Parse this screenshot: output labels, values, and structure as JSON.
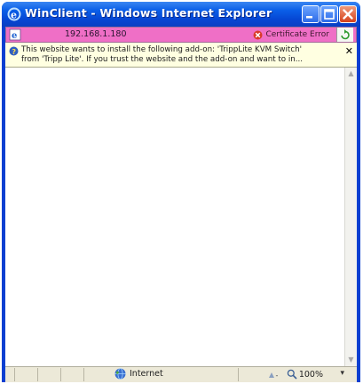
{
  "window": {
    "title": "WinClient - Windows Internet Explorer"
  },
  "address_bar": {
    "url": "192.168.1.180",
    "cert_error_label": "Certificate Error"
  },
  "info_bar": {
    "line1": "This website wants to install the following add-on: 'TrippLite KVM Switch'",
    "line2": "from 'Tripp Lite'. If you trust the website and the add-on and want to in..."
  },
  "status_bar": {
    "zone_label": "Internet",
    "zoom_label": "100%"
  },
  "icons": {
    "browser": "ie-icon",
    "minimize": "minimize-icon",
    "maximize": "maximize-icon",
    "close": "close-icon",
    "cert_error": "certificate-error-icon",
    "refresh": "refresh-icon",
    "info": "shield-info-icon",
    "zone": "globe-icon",
    "zoom": "magnifier-icon"
  },
  "colors": {
    "titlebar": "#0a5ee8",
    "address_bar": "#ef6fc6",
    "info_bar": "#ffffe1",
    "close_button": "#d5421c"
  }
}
